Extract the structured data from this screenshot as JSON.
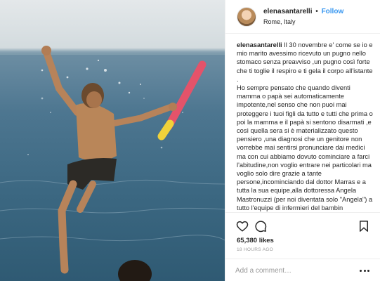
{
  "post": {
    "username": "elenasantarelli",
    "follow_label": "Follow",
    "separator": "•",
    "location": "Rome, Italy"
  },
  "caption": {
    "username": "elenasantarelli",
    "text": " Il 30 novembre e' come se io e mio marito avessimo ricevuto un pugno nello stomaco senza preavviso ,un pugno così forte che ti toglie il respiro e ti gela il corpo all'istante .\nHo sempre pensato che quando diventi mamma o papà sei automaticamente impotente,nel senso che non puoi mai proteggere i tuoi figli da tutto e tutti che prima o poi la mamma e il papà si sentono disarmati ,e così quella sera si è materializzato questo pensiero ,una diagnosi che un genitore non vorrebbe mai sentirsi pronunciare dai medici ma con cui abbiamo dovuto cominciare a farci l'abitudine,non voglio entrare nei particolari ma voglio solo dire grazie a tante persone,incominciando dal dottor Marras e a tutta la sua equipe,alla dottoressa Angela Mastronuzzi (per noi diventata solo \"Angela\") a tutto l'equipe di infermieri del bambin"
  },
  "actions": {
    "like_icon": "heart-icon",
    "comment_icon": "comment-icon",
    "save_icon": "bookmark-icon",
    "likes_count": "65,380 likes",
    "time_ago": "18 HOURS AGO"
  },
  "comment": {
    "placeholder": "Add a comment…",
    "more_icon": "more-horizontal-icon"
  },
  "colors": {
    "accent": "#3897f0",
    "text": "#262626",
    "muted": "#999999",
    "border": "#efefef"
  }
}
